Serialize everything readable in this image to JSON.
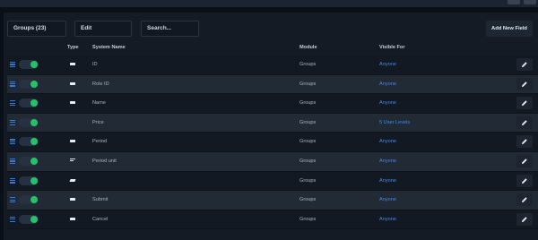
{
  "toolbar": {
    "groups_label": "Groups (23)",
    "edit_label": "Edit",
    "search_placeholder": "Search...",
    "add_button": "Add New Field"
  },
  "columns": {
    "type": "Type",
    "system_name": "System Name",
    "module": "Module",
    "visible_for": "Visible For"
  },
  "rows": [
    {
      "type_icon": "single-line-icon",
      "name": "ID",
      "module": "Groups",
      "visible": "Anyone"
    },
    {
      "type_icon": "single-line-icon",
      "name": "Role ID",
      "module": "Groups",
      "visible": "Anyone"
    },
    {
      "type_icon": "single-line-icon",
      "name": "Name",
      "module": "Groups",
      "visible": "Anyone"
    },
    {
      "type_icon": "none",
      "name": "Price",
      "module": "Groups",
      "visible": "5 User Levels"
    },
    {
      "type_icon": "single-line-icon",
      "name": "Period",
      "module": "Groups",
      "visible": "Anyone"
    },
    {
      "type_icon": "multi-line-icon",
      "name": "Period unit",
      "module": "Groups",
      "visible": "Anyone"
    },
    {
      "type_icon": "tag-icon",
      "name": "",
      "module": "Groups",
      "visible": "Anyone"
    },
    {
      "type_icon": "single-line-icon",
      "name": "Submit",
      "module": "Groups",
      "visible": "Anyone"
    },
    {
      "type_icon": "single-line-icon",
      "name": "Cancel",
      "module": "Groups",
      "visible": "Anyone"
    }
  ],
  "colors": {
    "accent": "#3b8df3",
    "toggle_on": "#25c26a"
  }
}
